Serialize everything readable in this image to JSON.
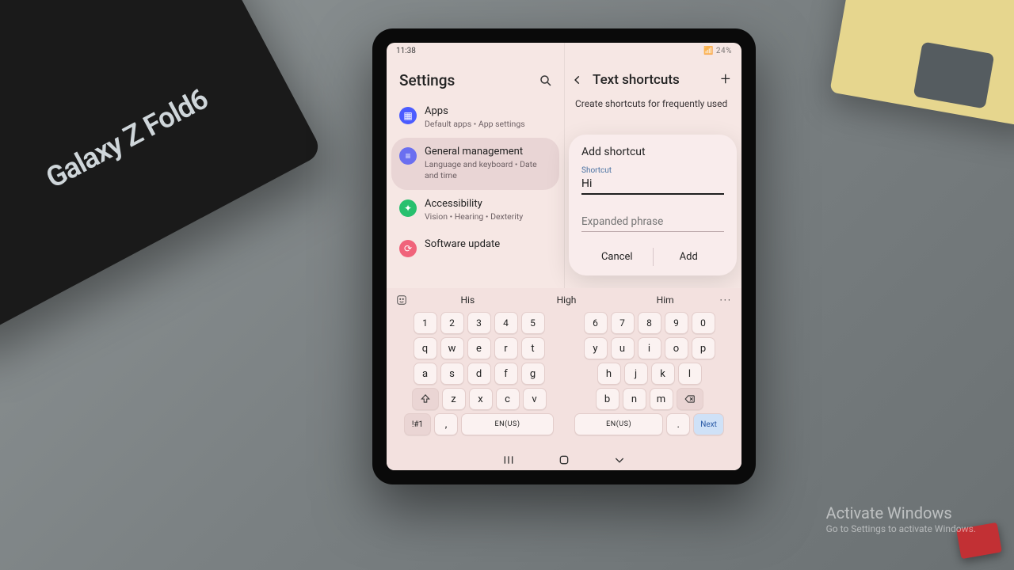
{
  "status": {
    "time": "11:38",
    "right": "📶 24%"
  },
  "box_label": "Galaxy Z Fold6",
  "watermark": {
    "title": "Activate Windows",
    "sub": "Go to Settings to activate Windows."
  },
  "left": {
    "title": "Settings",
    "items": [
      {
        "icon_bg": "#4b5cff",
        "label": "Apps",
        "sub": "Default apps  •  App settings"
      },
      {
        "icon_bg": "#6a6ff0",
        "label": "General management",
        "sub": "Language and keyboard  •  Date and time"
      },
      {
        "icon_bg": "#27c06e",
        "label": "Accessibility",
        "sub": "Vision  •  Hearing  •  Dexterity"
      },
      {
        "icon_bg": "#f0637a",
        "label": "Software update",
        "sub": ""
      }
    ]
  },
  "right": {
    "title": "Text shortcuts",
    "desc": "Create shortcuts for frequently used"
  },
  "dialog": {
    "title": "Add shortcut",
    "field1_label": "Shortcut",
    "field1_value": "Hi",
    "field2_placeholder": "Expanded phrase",
    "cancel": "Cancel",
    "add": "Add"
  },
  "suggestions": {
    "s1": "His",
    "s2": "High",
    "s3": "Him",
    "more": "···"
  },
  "keys": {
    "numL": [
      "1",
      "2",
      "3",
      "4",
      "5"
    ],
    "numR": [
      "6",
      "7",
      "8",
      "9",
      "0"
    ],
    "r1L": [
      "q",
      "w",
      "e",
      "r",
      "t"
    ],
    "r1R": [
      "y",
      "u",
      "i",
      "o",
      "p"
    ],
    "r2L": [
      "a",
      "s",
      "d",
      "f",
      "g"
    ],
    "r2R": [
      "h",
      "j",
      "k",
      "l"
    ],
    "r3L": [
      "z",
      "x",
      "c",
      "v"
    ],
    "r3R": [
      "b",
      "n",
      "m"
    ],
    "sym": "!#1",
    "comma": ",",
    "lang": "EN(US)",
    "period": ".",
    "next": "Next"
  }
}
